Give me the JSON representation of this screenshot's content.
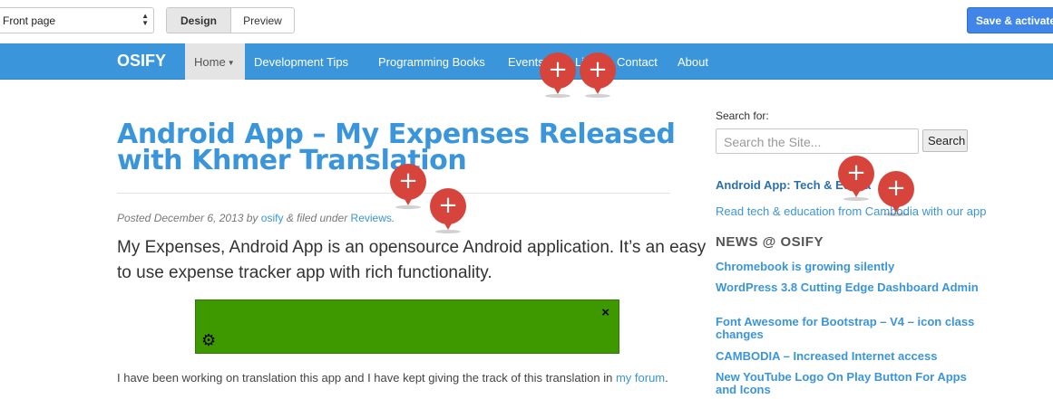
{
  "toolbar": {
    "page_select": "Front page",
    "design_label": "Design",
    "preview_label": "Preview",
    "save_label": "Save & activate"
  },
  "navbar": {
    "brand": "OSIFY",
    "items": [
      {
        "label": "Home"
      },
      {
        "label": "Development Tips"
      },
      {
        "label": "Programming Books"
      },
      {
        "label": "Events"
      },
      {
        "label": "Li"
      },
      {
        "label": "Contact"
      },
      {
        "label": "About"
      }
    ]
  },
  "post": {
    "title": "Android App – My Expenses Released with Khmer Translation",
    "meta_prefix": "Posted December 6, 2013 by",
    "author": "osify",
    "meta_mid": "& filed under",
    "category": "Reviews",
    "meta_suffix": ".",
    "lead": "My Expenses, Android App is an opensource Android application. It’s an easy to use expense tracker app with rich functionality.",
    "ad_close": "×",
    "ad_settings_icon": "gear-icon",
    "body_text": "I have been working on translation this app and I have kept giving the track of this translation in",
    "body_link": "my forum",
    "body_suffix": "."
  },
  "sidebar": {
    "search_label": "Search for:",
    "search_placeholder": "Search the Site...",
    "search_button": "Search",
    "promo_title": "Android App: Tech & Educa",
    "promo_text": "Read tech & education from Cambodia with our app",
    "news_heading": "NEWS @ OSIFY",
    "news": [
      "Chromebook is growing silently",
      "WordPress 3.8 Cutting Edge Dashboard Admin",
      "Font Awesome for Bootstrap – V4 – icon class changes",
      "CAMBODIA – Increased Internet access",
      "New YouTube Logo On Play Button For Apps and Icons"
    ]
  },
  "markers": {
    "symbol": "+",
    "icon": "add-marker-icon"
  },
  "colors": {
    "accent": "#3a95da",
    "save_button": "#3f86e8",
    "marker": "#d6443b",
    "ad_background": "#3e9800"
  }
}
